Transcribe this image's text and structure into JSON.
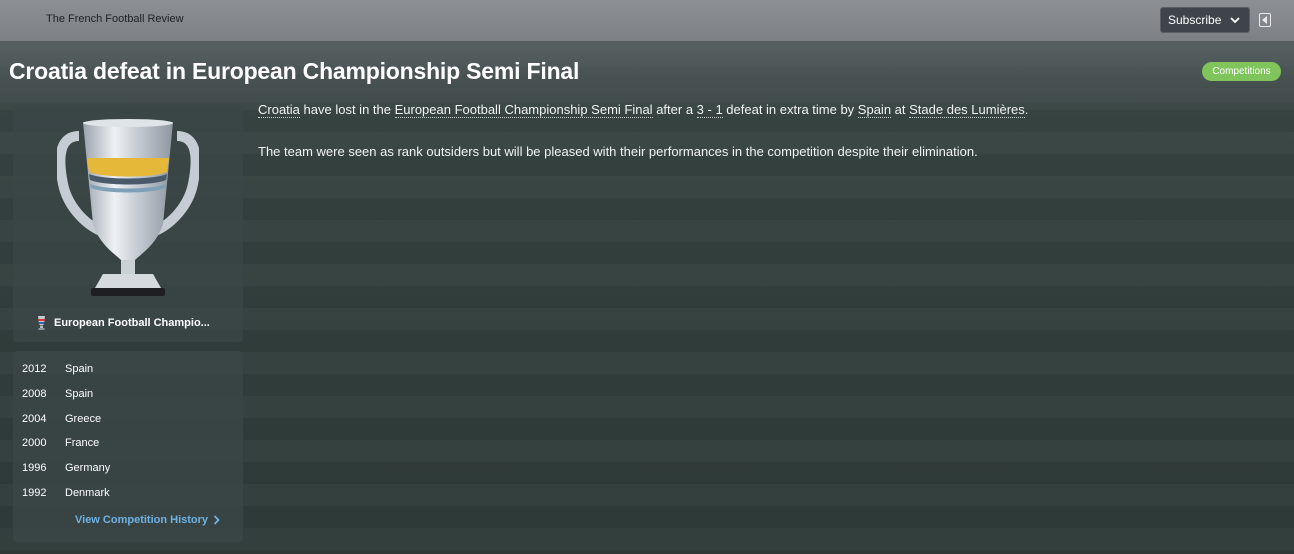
{
  "topbar": {
    "source": "The French Football Review",
    "subscribe_label": "Subscribe",
    "subscribe_icon": "chevron-down-icon",
    "collapse_icon": "collapse-panel-icon"
  },
  "headline": "Croatia defeat in European Championship Semi Final",
  "tag": "Competitions",
  "competition": {
    "name": "European Football Champio...",
    "trophy_icon": "trophy-icon",
    "logo_icon": "competition-logo-icon"
  },
  "history": [
    {
      "year": "2012",
      "winner": "Spain"
    },
    {
      "year": "2008",
      "winner": "Spain"
    },
    {
      "year": "2004",
      "winner": "Greece"
    },
    {
      "year": "2000",
      "winner": "France"
    },
    {
      "year": "1996",
      "winner": "Germany"
    },
    {
      "year": "1992",
      "winner": "Denmark"
    }
  ],
  "history_link": "View Competition History",
  "article": {
    "p1": {
      "team": "Croatia",
      "t1": " have lost in the ",
      "competition": "European Football Championship Semi Final",
      "t2": " after a ",
      "score": "3 - 1",
      "t3": " defeat in extra time by ",
      "opponent": "Spain",
      "t4": " at ",
      "stadium": "Stade des Lumières",
      "t5": "."
    },
    "p2": "The team were seen as rank outsiders but will be pleased with their performances in the competition despite their elimination."
  },
  "colors": {
    "accent_link": "#6fb2e3",
    "tag_green": "#7fc55b"
  }
}
